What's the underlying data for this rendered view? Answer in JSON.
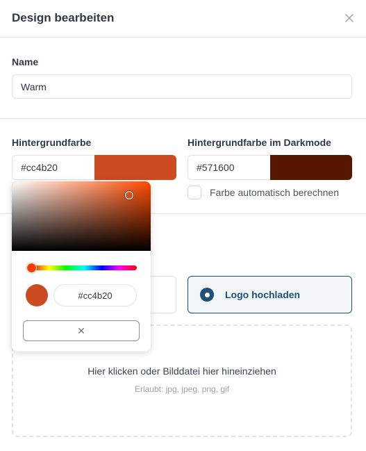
{
  "header": {
    "title": "Design bearbeiten",
    "close_icon": "close-icon"
  },
  "name_field": {
    "label": "Name",
    "value": "Warm"
  },
  "background": {
    "label": "Hintergrundfarbe",
    "value": "#cc4b20",
    "swatch_color": "#cc4b20"
  },
  "dark_background": {
    "label": "Hintergrundfarbe im Darkmode",
    "value": "#571600",
    "swatch_color": "#571600",
    "auto_checkbox_label": "Farbe automatisch berechnen"
  },
  "logo": {
    "upload_option_label": "Logo hochladen"
  },
  "dropzone": {
    "main_text": "Hier klicken oder Bilddatei hier hineinziehen",
    "hint_text": "Erlaubt: jpg, jpeg, png, gif"
  },
  "color_picker": {
    "hex_value": "#cc4b20",
    "preview_color": "#cc4b20",
    "clear_symbol": "✕"
  }
}
